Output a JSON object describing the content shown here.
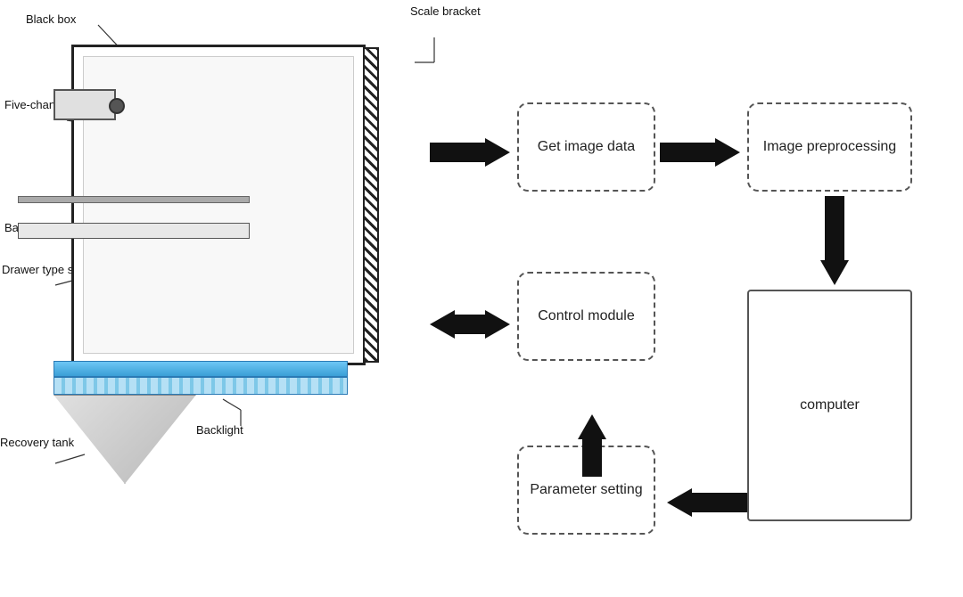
{
  "labels": {
    "black_box": "Black box",
    "scale_bracket": "Scale bracket",
    "five_channel_camera": "Five-channel camera",
    "bar_light": "Bar light",
    "drawer_type_stage": "Drawer type stage",
    "recovery_tank": "Recovery tank",
    "backlight": "Backlight"
  },
  "flow": {
    "get_image_data": "Get image\ndata",
    "image_preprocessing": "Image\npreprocessing",
    "control_module": "Control\nmodule",
    "parameter_setting": "Parameter\nsetting",
    "computer": "computer"
  }
}
